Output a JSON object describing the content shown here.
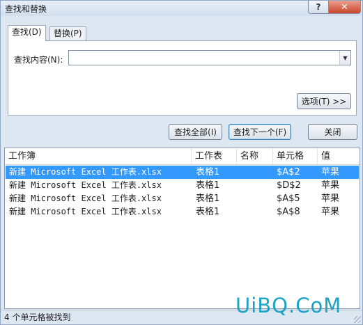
{
  "window": {
    "title": "查找和替换",
    "help_label": "?",
    "close_label": "✕"
  },
  "tabs": [
    {
      "label": "查找(D)",
      "active": true
    },
    {
      "label": "替换(P)",
      "active": false
    }
  ],
  "find": {
    "label": "查找内容(N):",
    "value": "",
    "placeholder": ""
  },
  "buttons": {
    "options": "选项(T) >>",
    "find_all": "查找全部(I)",
    "find_next": "查找下一个(F)",
    "close": "关闭"
  },
  "results": {
    "columns": [
      "工作簿",
      "工作表",
      "名称",
      "单元格",
      "值"
    ],
    "rows": [
      {
        "workbook": "新建 Microsoft Excel 工作表.xlsx",
        "sheet": "表格1",
        "name": "",
        "cell": "$A$2",
        "value": "苹果",
        "selected": true
      },
      {
        "workbook": "新建 Microsoft Excel 工作表.xlsx",
        "sheet": "表格1",
        "name": "",
        "cell": "$D$2",
        "value": "苹果",
        "selected": false
      },
      {
        "workbook": "新建 Microsoft Excel 工作表.xlsx",
        "sheet": "表格1",
        "name": "",
        "cell": "$A$5",
        "value": "苹果",
        "selected": false
      },
      {
        "workbook": "新建 Microsoft Excel 工作表.xlsx",
        "sheet": "表格1",
        "name": "",
        "cell": "$A$8",
        "value": "苹果",
        "selected": false
      }
    ]
  },
  "status": {
    "text": "4 个单元格被找到"
  },
  "watermark": "UiBQ.CoM",
  "colors": {
    "selection": "#3399ff",
    "watermark": "#1aa3c7"
  }
}
